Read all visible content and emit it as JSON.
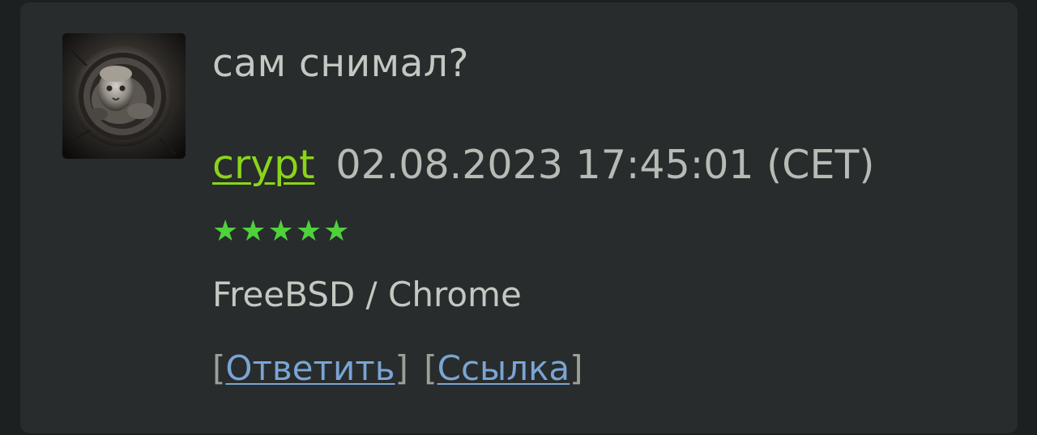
{
  "comment": {
    "message": "сам снимал?",
    "author": "crypt",
    "timestamp": "02.08.2023 17:45:01 (CET)",
    "rating": {
      "stars": "★★★★★",
      "value": 5,
      "max": 5
    },
    "client": "FreeBSD / Chrome",
    "actions": {
      "bracket_open": "[",
      "bracket_close": "]",
      "reply_label": "Ответить",
      "link_label": "Ссылка"
    }
  },
  "colors": {
    "card_background": "#282c2c",
    "username": "#8bd418",
    "stars": "#4fd13c",
    "link": "#7aa5d4",
    "text": "#c4c8c2"
  },
  "icons": {
    "avatar": "cherub-medallion-avatar"
  }
}
